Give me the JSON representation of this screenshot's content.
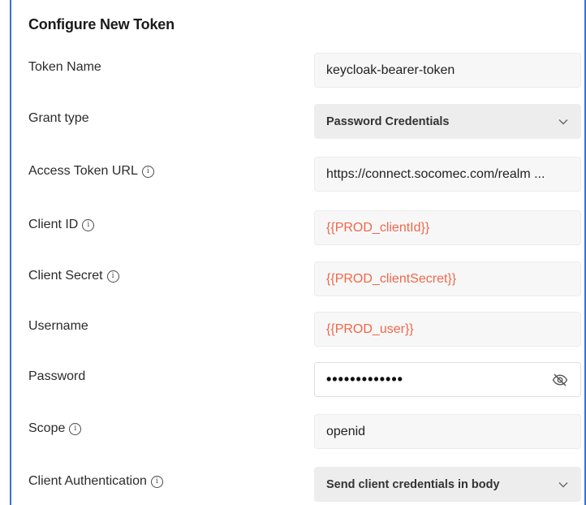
{
  "title": "Configure New Token",
  "fields": {
    "token_name": {
      "label": "Token Name",
      "value": "keycloak-bearer-token"
    },
    "grant_type": {
      "label": "Grant type",
      "value": "Password Credentials"
    },
    "access_token_url": {
      "label": "Access Token URL",
      "value": "https://connect.socomec.com/realm ..."
    },
    "client_id": {
      "label": "Client ID",
      "value": "{{PROD_clientId}}"
    },
    "client_secret": {
      "label": "Client Secret",
      "value": "{{PROD_clientSecret}}"
    },
    "username": {
      "label": "Username",
      "value": "{{PROD_user}}"
    },
    "password": {
      "label": "Password",
      "value": "•••••••••••••"
    },
    "scope": {
      "label": "Scope",
      "value": "openid"
    },
    "client_authentication": {
      "label": "Client Authentication",
      "value": "Send client credentials in body"
    }
  },
  "icons": {
    "info": "info-icon",
    "chevron": "chevron-down-icon",
    "eye": "eye-off-icon"
  },
  "colors": {
    "variable_text": "#f0674a",
    "frame": "#3b6fd6"
  }
}
